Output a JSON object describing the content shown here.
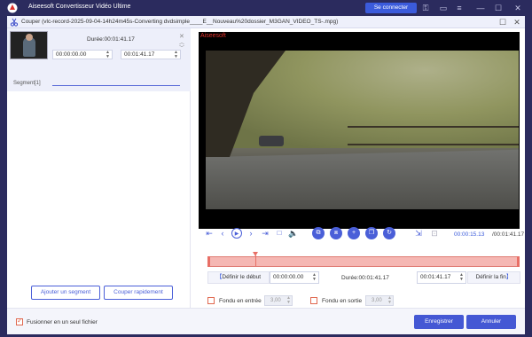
{
  "app": {
    "title": "Aiseesoft Convertisseur Vidéo Ultime",
    "connect_label": "Se connecter"
  },
  "dialog": {
    "title": "Couper (vlc-record-2025-09-04-14h24m45s-Converting dvdsimple____E__Nouveau%20dossier_M3GAN_VIDEO_TS-.mpg)"
  },
  "segment": {
    "duration": "Durée:00:01:41.17",
    "start": "00:00:00.00",
    "end": "00:01:41.17",
    "label": "Segment[1]"
  },
  "left_buttons": {
    "add_segment": "Ajouter un segment",
    "quick_split": "Couper rapidement"
  },
  "video": {
    "watermark": "Aiseesoft",
    "current_time": "00:00:15.13",
    "total_time": "/00:01:41.17",
    "cursor_fraction": 0.15
  },
  "trim": {
    "set_start": "Définir le début",
    "start_value": "00:00:00.00",
    "duration": "Durée:00:01:41.17",
    "end_value": "00:01:41.17",
    "set_end": "Définir la fin"
  },
  "fade": {
    "fade_in_label": "Fondu en entrée",
    "fade_in_value": "3,00",
    "fade_out_label": "Fondu en sortie",
    "fade_out_value": "3,00"
  },
  "footer": {
    "merge_label": "Fusionner en un seul fichier",
    "save": "Enregistrer",
    "cancel": "Annuler"
  },
  "colors": {
    "accent": "#4458d4",
    "timeline": "#f5b7b3",
    "timeline_handle": "#e86f66",
    "brand_red": "#e0302a"
  }
}
